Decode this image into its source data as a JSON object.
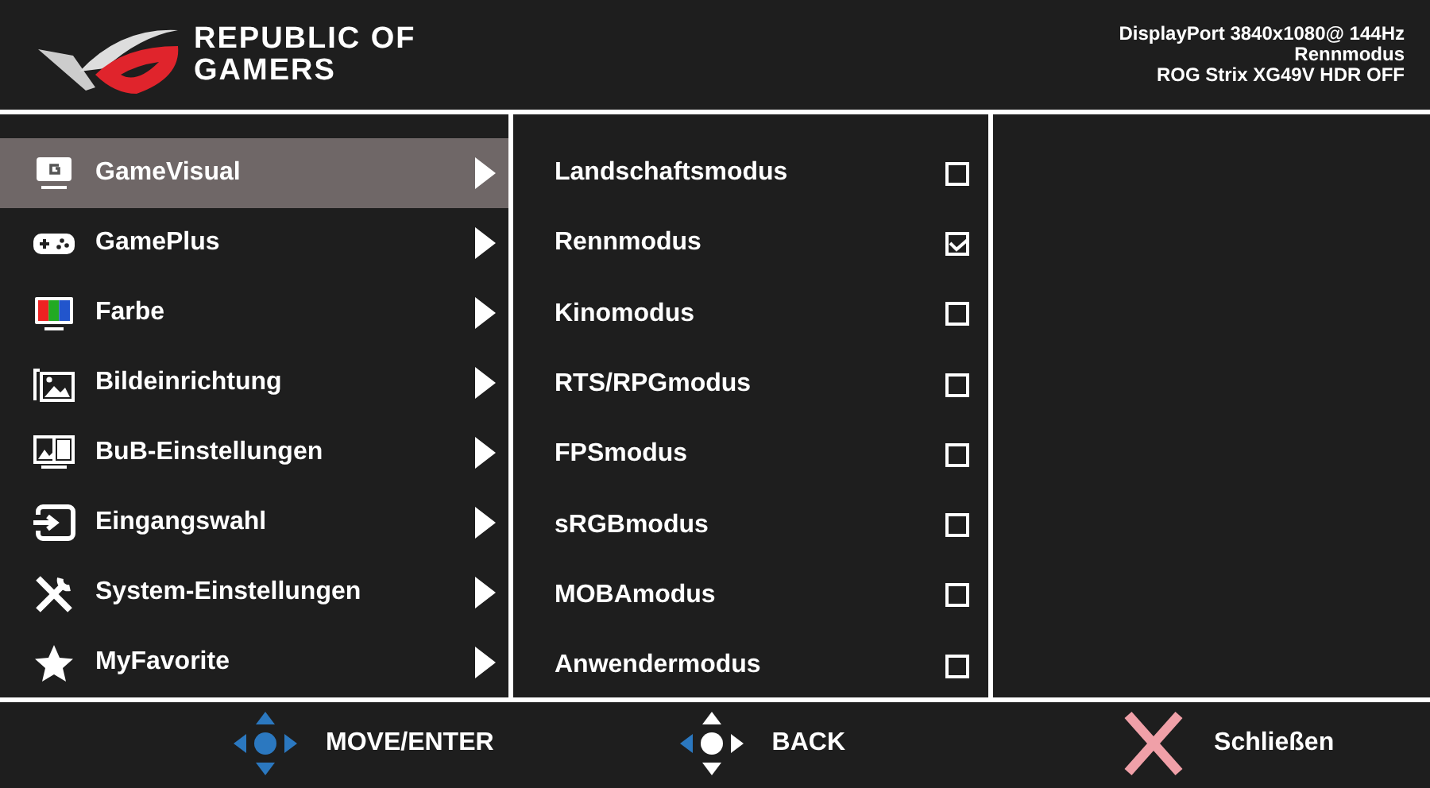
{
  "brand": {
    "line_1": "REPUBLIC OF",
    "line_2": "GAMERS"
  },
  "status": [
    "DisplayPort 3840x1080@ 144Hz",
    "Rennmodus",
    "ROG Strix XG49V HDR OFF"
  ],
  "menu": [
    {
      "label": "GameVisual",
      "kind": "gamevisual",
      "selected": true
    },
    {
      "label": "GamePlus",
      "kind": "gamepad",
      "selected": false
    },
    {
      "label": "Farbe",
      "kind": "color",
      "selected": false
    },
    {
      "label": "Bildeinrichtung",
      "kind": "image",
      "selected": false
    },
    {
      "label": "BuB-Einstellungen",
      "kind": "pbp",
      "selected": false
    },
    {
      "label": "Eingangswahl",
      "kind": "input",
      "selected": false
    },
    {
      "label": "System-Einstellungen",
      "kind": "tools",
      "selected": false
    },
    {
      "label": "MyFavorite",
      "kind": "star",
      "selected": false
    }
  ],
  "modes": [
    {
      "label": "Landschaftsmodus",
      "checked": false
    },
    {
      "label": "Rennmodus",
      "checked": true
    },
    {
      "label": "Kinomodus",
      "checked": false
    },
    {
      "label": "RTS/RPGmodus",
      "checked": false
    },
    {
      "label": "FPSmodus",
      "checked": false
    },
    {
      "label": "sRGBmodus",
      "checked": false
    },
    {
      "label": "MOBAmodus",
      "checked": false
    },
    {
      "label": "Anwendermodus",
      "checked": false
    }
  ],
  "footer": [
    {
      "label": "MOVE/ENTER",
      "kind": "move"
    },
    {
      "label": "BACK",
      "kind": "back"
    },
    {
      "label": "Schließen",
      "kind": "close"
    }
  ]
}
